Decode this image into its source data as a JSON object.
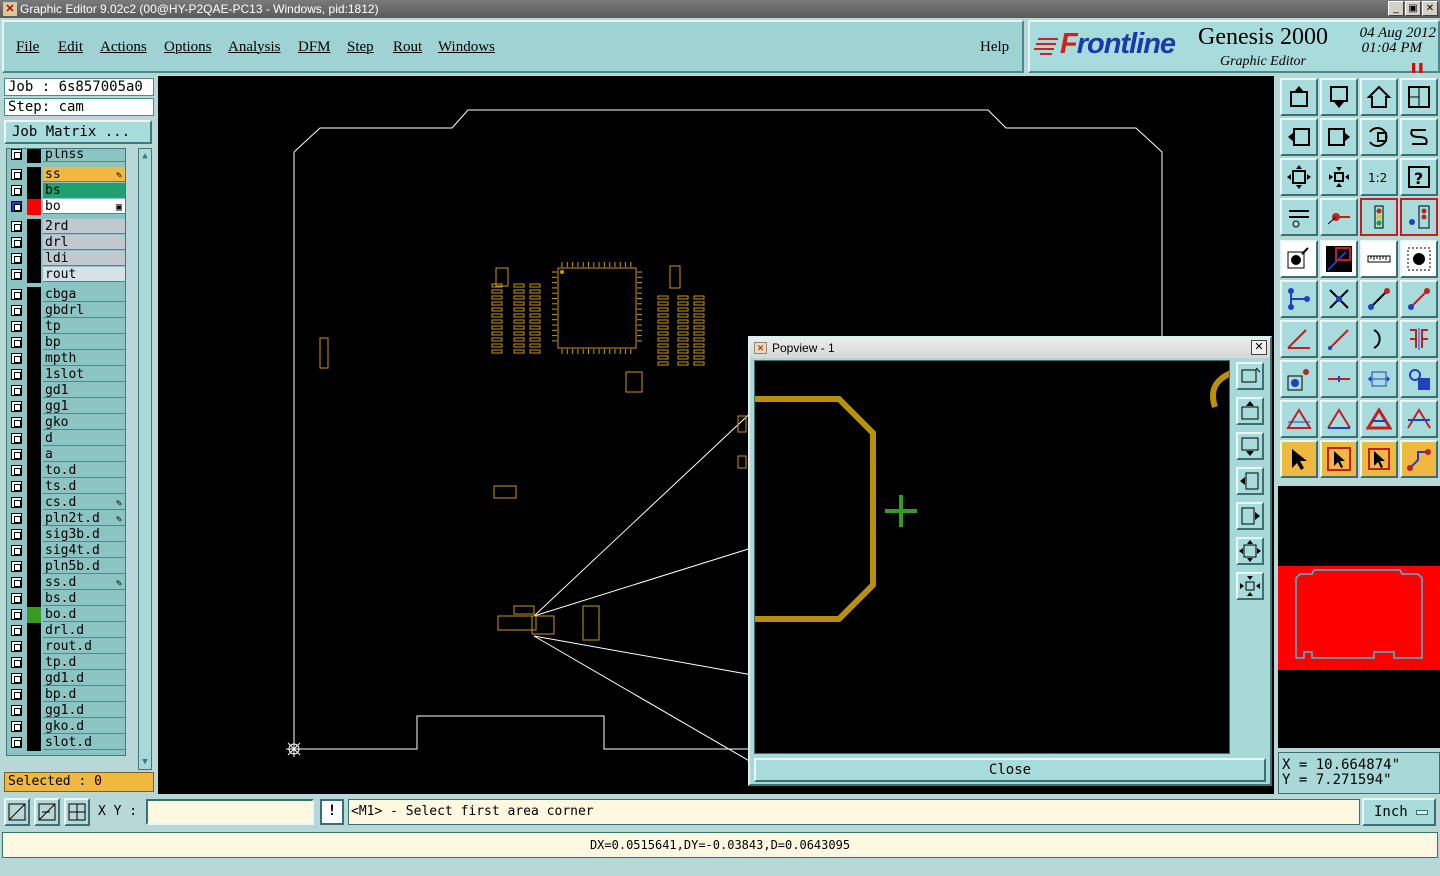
{
  "window": {
    "title": "Graphic Editor 9.02c2 (00@HY-P2QAE-PC13 - Windows, pid:1812)",
    "controls": [
      "_",
      "▣",
      "✕"
    ]
  },
  "menubar": {
    "items": [
      "File",
      "Edit",
      "Actions",
      "Options",
      "Analysis",
      "DFM",
      "Step",
      "Rout",
      "Windows"
    ],
    "help": "Help"
  },
  "brand": {
    "logo": "Frontline",
    "product": "Genesis 2000",
    "subtitle": "Graphic Editor",
    "date": "04 Aug 2012",
    "time": "01:04 PM"
  },
  "job": {
    "job_line": "Job : 6s857005a0",
    "step_line": "Step: cam",
    "matrix_button": "Job Matrix ...",
    "selected": "Selected : 0"
  },
  "layers": [
    {
      "name": "plnss",
      "color": "#000000",
      "mark": ""
    },
    {
      "name": "ss",
      "color": "#000000",
      "mark": "✎",
      "highlight": "#f0b840"
    },
    {
      "name": "bs",
      "color": "#000000",
      "mark": "",
      "highlight": "#20a070"
    },
    {
      "name": "bo",
      "color": "#ff0000",
      "mark": "▣",
      "highlight": "#ffffff",
      "active": true
    },
    {
      "name": "2rd",
      "color": "#000000",
      "mark": "",
      "highlight": "#c0c8d0"
    },
    {
      "name": "drl",
      "color": "#000000",
      "mark": "",
      "highlight": "#c0c8d0"
    },
    {
      "name": "ldi",
      "color": "#000000",
      "mark": "",
      "highlight": "#c0c8d0"
    },
    {
      "name": "rout",
      "color": "#000000",
      "mark": "",
      "highlight": "#d8e0e8"
    },
    {
      "name": "cbga",
      "color": "#000000",
      "mark": ""
    },
    {
      "name": "gbdrl",
      "color": "#000000",
      "mark": ""
    },
    {
      "name": "tp",
      "color": "#000000",
      "mark": ""
    },
    {
      "name": "bp",
      "color": "#000000",
      "mark": ""
    },
    {
      "name": "mpth",
      "color": "#000000",
      "mark": ""
    },
    {
      "name": "1slot",
      "color": "#000000",
      "mark": ""
    },
    {
      "name": "gd1",
      "color": "#000000",
      "mark": ""
    },
    {
      "name": "gg1",
      "color": "#000000",
      "mark": ""
    },
    {
      "name": "gko",
      "color": "#000000",
      "mark": ""
    },
    {
      "name": "d",
      "color": "#000000",
      "mark": ""
    },
    {
      "name": "a",
      "color": "#000000",
      "mark": ""
    },
    {
      "name": "to.d",
      "color": "#000000",
      "mark": ""
    },
    {
      "name": "ts.d",
      "color": "#000000",
      "mark": ""
    },
    {
      "name": "cs.d",
      "color": "#000000",
      "mark": "✎"
    },
    {
      "name": "pln2t.d",
      "color": "#000000",
      "mark": "✎"
    },
    {
      "name": "sig3b.d",
      "color": "#000000",
      "mark": ""
    },
    {
      "name": "sig4t.d",
      "color": "#000000",
      "mark": ""
    },
    {
      "name": "pln5b.d",
      "color": "#000000",
      "mark": ""
    },
    {
      "name": "ss.d",
      "color": "#000000",
      "mark": "✎"
    },
    {
      "name": "bs.d",
      "color": "#000000",
      "mark": ""
    },
    {
      "name": "bo.d",
      "color": "#3a9a20",
      "mark": ""
    },
    {
      "name": "drl.d",
      "color": "#000000",
      "mark": ""
    },
    {
      "name": "rout.d",
      "color": "#000000",
      "mark": ""
    },
    {
      "name": "tp.d",
      "color": "#000000",
      "mark": ""
    },
    {
      "name": "gd1.d",
      "color": "#000000",
      "mark": ""
    },
    {
      "name": "bp.d",
      "color": "#000000",
      "mark": ""
    },
    {
      "name": "gg1.d",
      "color": "#000000",
      "mark": ""
    },
    {
      "name": "gko.d",
      "color": "#000000",
      "mark": ""
    },
    {
      "name": "slot.d",
      "color": "#000000",
      "mark": ""
    }
  ],
  "popview": {
    "title": "Popview - 1",
    "close": "Close"
  },
  "coords": {
    "x": "X = 10.664874\"",
    "y": "Y = 7.271594\""
  },
  "command": {
    "xy_label": "X Y :",
    "xy_value": "",
    "bang": "!",
    "prompt": "<M1> - Select first area corner",
    "units": "Inch"
  },
  "status": {
    "text": "DX=0.0515641,DY=-0.03843,D=0.0643095"
  },
  "colors": {
    "panel": "#a8dcdc",
    "outline": "#ffffff",
    "component": "#c8961e",
    "profile": "#b8900c",
    "cursor": "#3a9a20"
  }
}
